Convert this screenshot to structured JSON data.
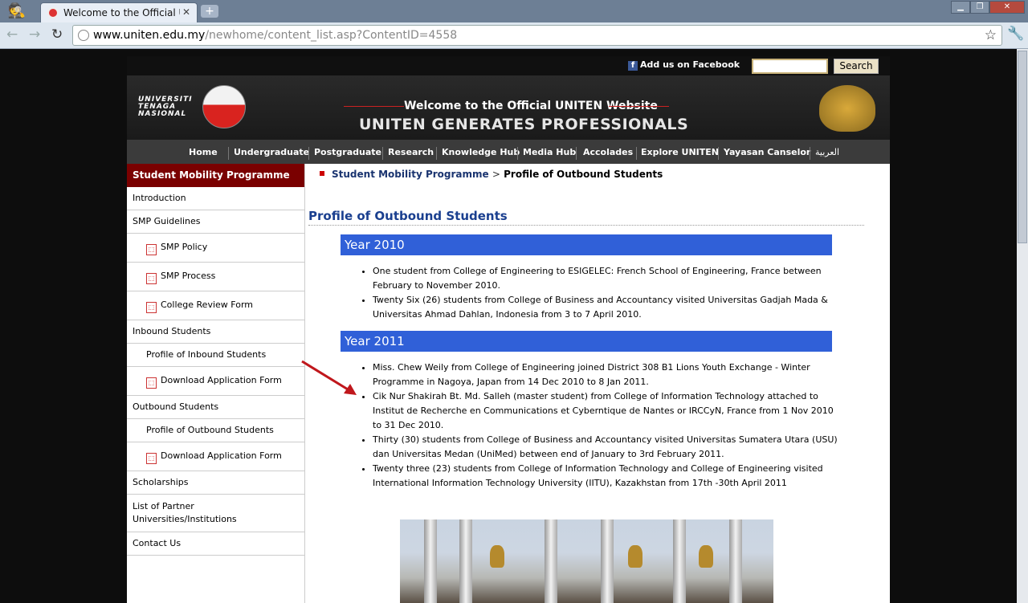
{
  "browser": {
    "tab_title": "Welcome to the Official Univer",
    "tab_close": "✕",
    "new_tab": "+",
    "url_host": "www.uniten.edu.my",
    "url_path": "/newhome/content_list.asp?ContentID=4558",
    "back": "←",
    "forward": "→",
    "reload": "↻"
  },
  "topstrip": {
    "facebook_label": "Add us on Facebook",
    "search_value": "",
    "search_button": "Search"
  },
  "banner": {
    "logo_text": "UNIVERSITI TENAGA NASIONAL",
    "welcome": "Welcome to the Official UNITEN Website",
    "slogan": "UNITEN GENERATES PROFESSIONALS"
  },
  "menu": [
    "Home",
    "Undergraduate",
    "Postgraduate",
    "Research",
    "Knowledge Hub",
    "Media Hub",
    "Accolades",
    "Explore UNITEN",
    "Yayasan Canselor",
    "العربية"
  ],
  "sidebar": {
    "header": "Student Mobility Programme",
    "items": [
      {
        "label": "Introduction",
        "sub": false,
        "pdf": false
      },
      {
        "label": "SMP Guidelines",
        "sub": false,
        "pdf": false
      },
      {
        "label": "SMP Policy",
        "sub": true,
        "pdf": true
      },
      {
        "label": "SMP Process",
        "sub": true,
        "pdf": true
      },
      {
        "label": "College Review Form",
        "sub": true,
        "pdf": true
      },
      {
        "label": "Inbound Students",
        "sub": false,
        "pdf": false
      },
      {
        "label": "Profile of Inbound Students",
        "sub": true,
        "pdf": false
      },
      {
        "label": "Download Application Form",
        "sub": true,
        "pdf": true
      },
      {
        "label": "Outbound Students",
        "sub": false,
        "pdf": false
      },
      {
        "label": "Profile of Outbound Students",
        "sub": true,
        "pdf": false
      },
      {
        "label": "Download Application Form",
        "sub": true,
        "pdf": true
      },
      {
        "label": "Scholarships",
        "sub": false,
        "pdf": false
      },
      {
        "label": "List of Partner Universities/Institutions",
        "sub": false,
        "pdf": false
      },
      {
        "label": "Contact Us",
        "sub": false,
        "pdf": false
      }
    ]
  },
  "breadcrumb": {
    "parent": "Student Mobility Programme",
    "separator": ">",
    "current": "Profile of Outbound Students"
  },
  "content": {
    "title": "Profile of Outbound Students",
    "year2010": {
      "heading": "Year 2010",
      "items": [
        "One student from College of Engineering to ESIGELEC: French School of Engineering, France between February to November 2010.",
        "Twenty Six (26) students from College of Business and Accountancy visited Universitas Gadjah Mada & Universitas Ahmad Dahlan, Indonesia from 3 to 7 April 2010."
      ]
    },
    "year2011": {
      "heading": "Year 2011",
      "items": [
        "Miss. Chew Weily from College of Engineering joined District 308 B1 Lions Youth Exchange - Winter Programme in Nagoya, Japan from 14 Dec 2010 to 8 Jan 2011.",
        "Cik Nur Shakirah Bt. Md. Salleh (master student) from College of Information Technology attached to Institut de Recherche en Communications et Cyberntique de Nantes or IRCCyN, France from 1 Nov 2010 to 31 Dec 2010.",
        "Thirty (30) students from College of Business and Accountancy visited Universitas Sumatera Utara (USU) dan Universitas Medan (UniMed) between end of January to 3rd February 2011.",
        "Twenty three (23) students from College of Information Technology and College of Engineering visited International Information Technology University (IITU), Kazakhstan from 17th -30th April 2011"
      ]
    }
  }
}
